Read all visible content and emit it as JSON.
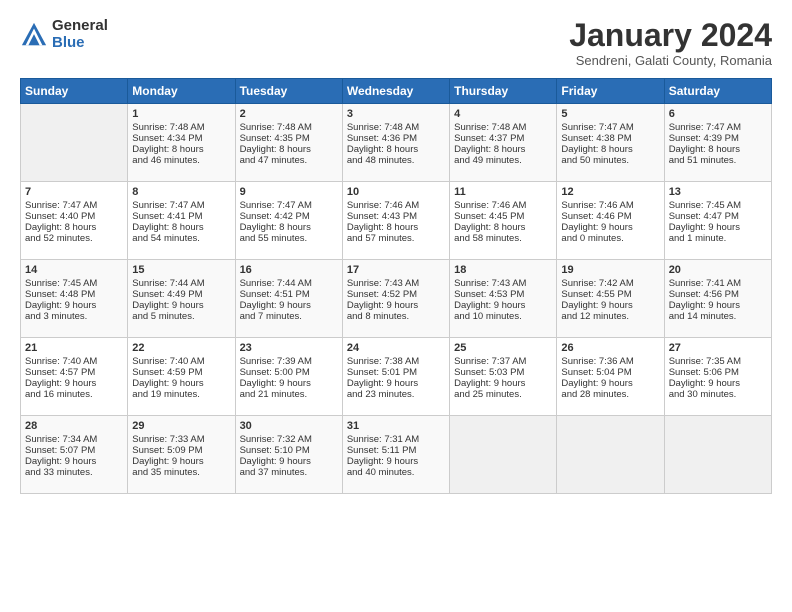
{
  "header": {
    "logo_general": "General",
    "logo_blue": "Blue",
    "month_title": "January 2024",
    "subtitle": "Sendreni, Galati County, Romania"
  },
  "days_of_week": [
    "Sunday",
    "Monday",
    "Tuesday",
    "Wednesday",
    "Thursday",
    "Friday",
    "Saturday"
  ],
  "weeks": [
    [
      {
        "day": "",
        "content": ""
      },
      {
        "day": "1",
        "content": "Sunrise: 7:48 AM\nSunset: 4:34 PM\nDaylight: 8 hours\nand 46 minutes."
      },
      {
        "day": "2",
        "content": "Sunrise: 7:48 AM\nSunset: 4:35 PM\nDaylight: 8 hours\nand 47 minutes."
      },
      {
        "day": "3",
        "content": "Sunrise: 7:48 AM\nSunset: 4:36 PM\nDaylight: 8 hours\nand 48 minutes."
      },
      {
        "day": "4",
        "content": "Sunrise: 7:48 AM\nSunset: 4:37 PM\nDaylight: 8 hours\nand 49 minutes."
      },
      {
        "day": "5",
        "content": "Sunrise: 7:47 AM\nSunset: 4:38 PM\nDaylight: 8 hours\nand 50 minutes."
      },
      {
        "day": "6",
        "content": "Sunrise: 7:47 AM\nSunset: 4:39 PM\nDaylight: 8 hours\nand 51 minutes."
      }
    ],
    [
      {
        "day": "7",
        "content": "Sunrise: 7:47 AM\nSunset: 4:40 PM\nDaylight: 8 hours\nand 52 minutes."
      },
      {
        "day": "8",
        "content": "Sunrise: 7:47 AM\nSunset: 4:41 PM\nDaylight: 8 hours\nand 54 minutes."
      },
      {
        "day": "9",
        "content": "Sunrise: 7:47 AM\nSunset: 4:42 PM\nDaylight: 8 hours\nand 55 minutes."
      },
      {
        "day": "10",
        "content": "Sunrise: 7:46 AM\nSunset: 4:43 PM\nDaylight: 8 hours\nand 57 minutes."
      },
      {
        "day": "11",
        "content": "Sunrise: 7:46 AM\nSunset: 4:45 PM\nDaylight: 8 hours\nand 58 minutes."
      },
      {
        "day": "12",
        "content": "Sunrise: 7:46 AM\nSunset: 4:46 PM\nDaylight: 9 hours\nand 0 minutes."
      },
      {
        "day": "13",
        "content": "Sunrise: 7:45 AM\nSunset: 4:47 PM\nDaylight: 9 hours\nand 1 minute."
      }
    ],
    [
      {
        "day": "14",
        "content": "Sunrise: 7:45 AM\nSunset: 4:48 PM\nDaylight: 9 hours\nand 3 minutes."
      },
      {
        "day": "15",
        "content": "Sunrise: 7:44 AM\nSunset: 4:49 PM\nDaylight: 9 hours\nand 5 minutes."
      },
      {
        "day": "16",
        "content": "Sunrise: 7:44 AM\nSunset: 4:51 PM\nDaylight: 9 hours\nand 7 minutes."
      },
      {
        "day": "17",
        "content": "Sunrise: 7:43 AM\nSunset: 4:52 PM\nDaylight: 9 hours\nand 8 minutes."
      },
      {
        "day": "18",
        "content": "Sunrise: 7:43 AM\nSunset: 4:53 PM\nDaylight: 9 hours\nand 10 minutes."
      },
      {
        "day": "19",
        "content": "Sunrise: 7:42 AM\nSunset: 4:55 PM\nDaylight: 9 hours\nand 12 minutes."
      },
      {
        "day": "20",
        "content": "Sunrise: 7:41 AM\nSunset: 4:56 PM\nDaylight: 9 hours\nand 14 minutes."
      }
    ],
    [
      {
        "day": "21",
        "content": "Sunrise: 7:40 AM\nSunset: 4:57 PM\nDaylight: 9 hours\nand 16 minutes."
      },
      {
        "day": "22",
        "content": "Sunrise: 7:40 AM\nSunset: 4:59 PM\nDaylight: 9 hours\nand 19 minutes."
      },
      {
        "day": "23",
        "content": "Sunrise: 7:39 AM\nSunset: 5:00 PM\nDaylight: 9 hours\nand 21 minutes."
      },
      {
        "day": "24",
        "content": "Sunrise: 7:38 AM\nSunset: 5:01 PM\nDaylight: 9 hours\nand 23 minutes."
      },
      {
        "day": "25",
        "content": "Sunrise: 7:37 AM\nSunset: 5:03 PM\nDaylight: 9 hours\nand 25 minutes."
      },
      {
        "day": "26",
        "content": "Sunrise: 7:36 AM\nSunset: 5:04 PM\nDaylight: 9 hours\nand 28 minutes."
      },
      {
        "day": "27",
        "content": "Sunrise: 7:35 AM\nSunset: 5:06 PM\nDaylight: 9 hours\nand 30 minutes."
      }
    ],
    [
      {
        "day": "28",
        "content": "Sunrise: 7:34 AM\nSunset: 5:07 PM\nDaylight: 9 hours\nand 33 minutes."
      },
      {
        "day": "29",
        "content": "Sunrise: 7:33 AM\nSunset: 5:09 PM\nDaylight: 9 hours\nand 35 minutes."
      },
      {
        "day": "30",
        "content": "Sunrise: 7:32 AM\nSunset: 5:10 PM\nDaylight: 9 hours\nand 37 minutes."
      },
      {
        "day": "31",
        "content": "Sunrise: 7:31 AM\nSunset: 5:11 PM\nDaylight: 9 hours\nand 40 minutes."
      },
      {
        "day": "",
        "content": ""
      },
      {
        "day": "",
        "content": ""
      },
      {
        "day": "",
        "content": ""
      }
    ]
  ]
}
